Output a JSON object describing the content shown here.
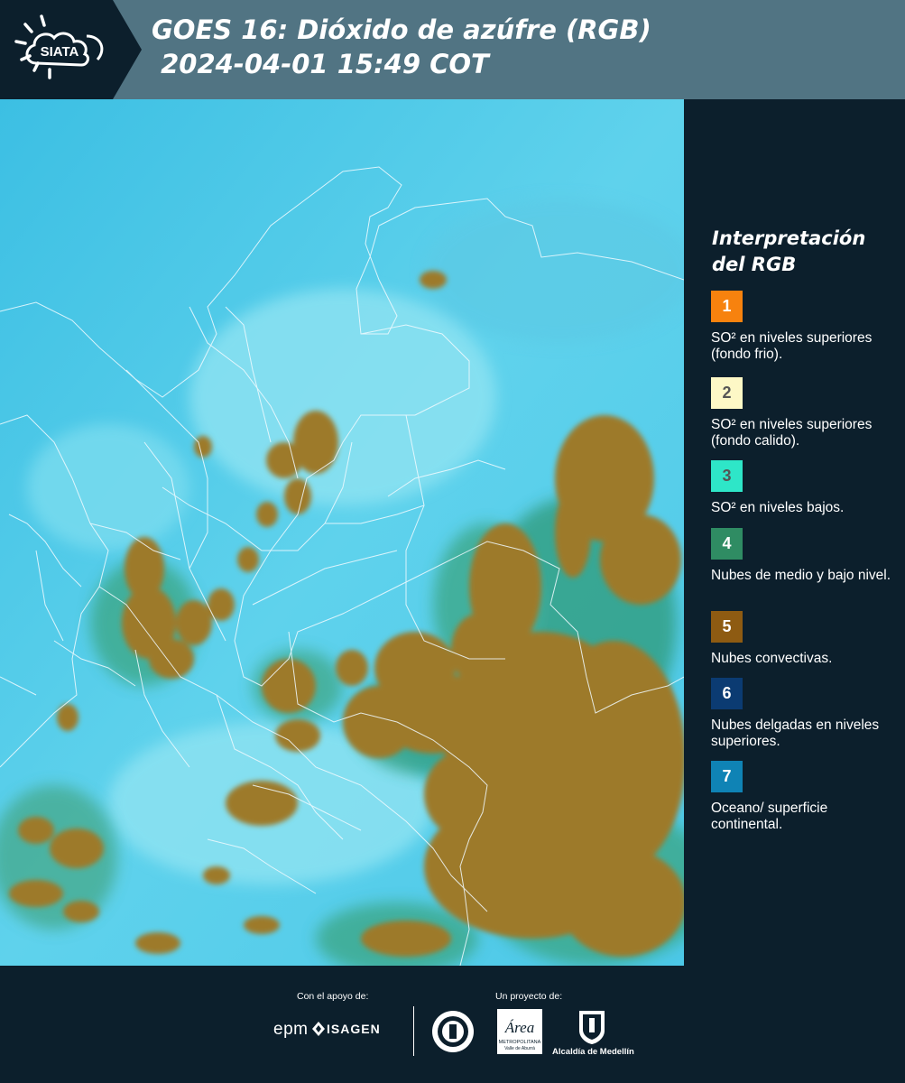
{
  "header": {
    "logo_text": "SIATA",
    "title_line1": "GOES 16: Dióxido de azúfre (RGB)",
    "title_line2": " 2024-04-01 15:49 COT"
  },
  "colors": {
    "header_bg": "#517483",
    "panel_bg": "#0c1f2c",
    "map_surface": "#45c6e6",
    "map_convective": "#9d7a2c"
  },
  "legend": {
    "title": "Interpretación del RGB",
    "items": [
      {
        "number": "1",
        "color": "#f7820e",
        "text": "SO² en niveles superiores (fondo frio)."
      },
      {
        "number": "2",
        "color": "#fdf8c6",
        "text": "SO² en niveles superiores (fondo calido)."
      },
      {
        "number": "3",
        "color": "#2ee6c8",
        "text": "SO² en niveles bajos."
      },
      {
        "number": "4",
        "color": "#2f8c63",
        "text": "Nubes de medio y bajo nivel."
      },
      {
        "number": "5",
        "color": "#8e5b12",
        "text": "Nubes convectivas."
      },
      {
        "number": "6",
        "color": "#0b3b72",
        "text": "Nubes delgadas en niveles superiores."
      },
      {
        "number": "7",
        "color": "#0f83b5",
        "text": "Oceano/ superficie continental."
      }
    ]
  },
  "footer": {
    "support_label": "Con el apoyo de:",
    "project_label": "Un proyecto de:",
    "epm": "epm",
    "isagen": "ISAGEN",
    "area_text": "Área",
    "area_sub": "METROPOLITANA",
    "area_sub2": "Valle de Aburrá",
    "alcaldia": "Alcaldía de Medellín"
  }
}
